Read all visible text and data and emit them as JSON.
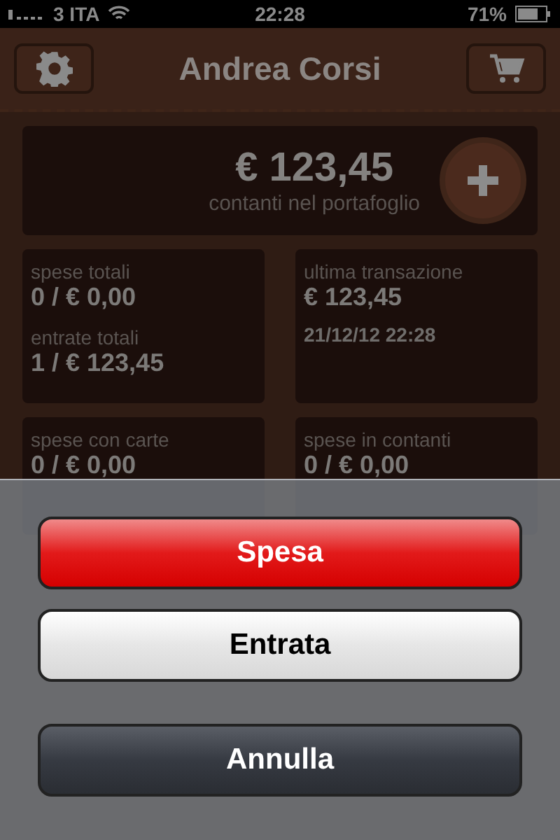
{
  "status_bar": {
    "carrier": "3 ITA",
    "time": "22:28",
    "battery": "71%"
  },
  "header": {
    "title": "Andrea Corsi"
  },
  "balance": {
    "amount": "€ 123,45",
    "caption": "contanti nel portafoglio"
  },
  "cards": [
    {
      "lines": [
        {
          "label": "spese totali",
          "value": "0 / € 0,00"
        },
        {
          "label": "entrate totali",
          "value": "1 / € 123,45"
        }
      ]
    },
    {
      "lines": [
        {
          "label": "ultima transazione",
          "value": "€ 123,45",
          "detail": "21/12/12 22:28"
        }
      ]
    },
    {
      "lines": [
        {
          "label": "spese con carte",
          "value": "0 / € 0,00"
        }
      ]
    },
    {
      "lines": [
        {
          "label": "spese in contanti",
          "value": "0 / € 0,00"
        }
      ]
    }
  ],
  "action_sheet": {
    "buttons": [
      {
        "kind": "destructive",
        "label": "Spesa"
      },
      {
        "kind": "default",
        "label": "Entrata"
      },
      {
        "kind": "cancel",
        "label": "Annulla"
      }
    ]
  }
}
